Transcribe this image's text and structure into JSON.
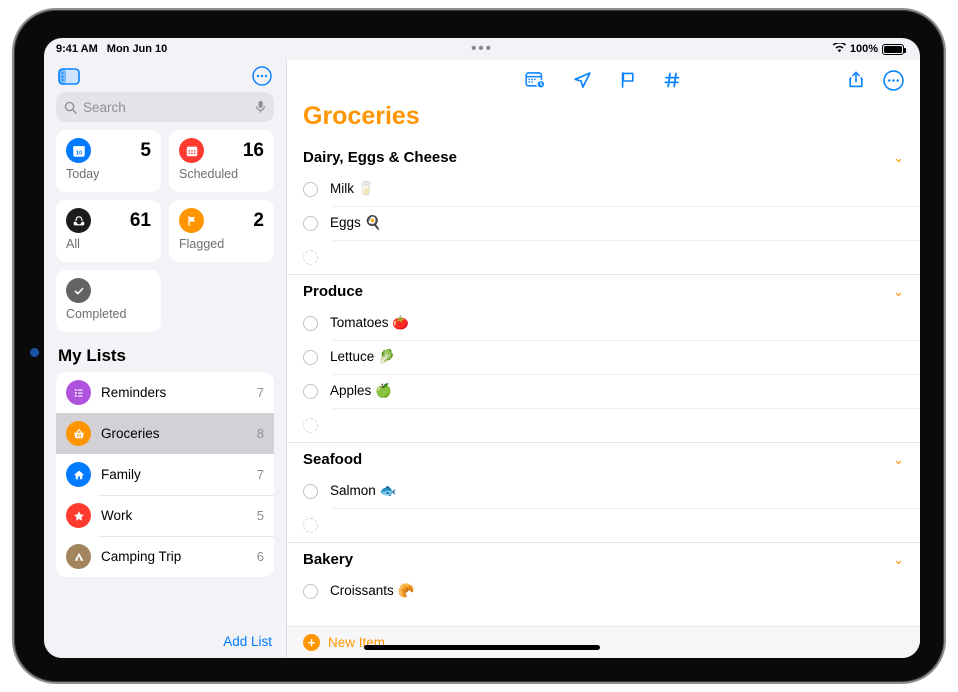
{
  "status_bar": {
    "time": "9:41 AM",
    "date": "Mon Jun 10",
    "wifi_icon": "wifi-icon",
    "battery_percent": "100%"
  },
  "sidebar": {
    "toggle_icon": "sidebar-toggle-icon",
    "more_icon": "more-options-icon",
    "search": {
      "placeholder": "Search",
      "search_icon": "search-icon",
      "mic_icon": "microphone-icon"
    },
    "smart_lists": [
      {
        "label": "Today",
        "count": "5",
        "icon": "calendar-day-icon",
        "color": "#007aff"
      },
      {
        "label": "Scheduled",
        "count": "16",
        "icon": "calendar-icon",
        "color": "#ff3b30"
      },
      {
        "label": "All",
        "count": "61",
        "icon": "inbox-tray-icon",
        "color": "#1c1c1e"
      },
      {
        "label": "Flagged",
        "count": "2",
        "icon": "flag-icon",
        "color": "#ff9500"
      },
      {
        "label": "Completed",
        "count": "",
        "icon": "checkmark-icon",
        "color": "#636366"
      }
    ],
    "my_lists_title": "My Lists",
    "lists": [
      {
        "name": "Reminders",
        "count": "7",
        "icon": "bulleted-list-icon",
        "color": "#af52de",
        "selected": false
      },
      {
        "name": "Groceries",
        "count": "8",
        "icon": "basket-icon",
        "color": "#ff9500",
        "selected": true
      },
      {
        "name": "Family",
        "count": "7",
        "icon": "house-icon",
        "color": "#007aff",
        "selected": false
      },
      {
        "name": "Work",
        "count": "5",
        "icon": "star-icon",
        "color": "#ff3b30",
        "selected": false
      },
      {
        "name": "Camping Trip",
        "count": "6",
        "icon": "tent-icon",
        "color": "#a2845e",
        "selected": false
      }
    ],
    "add_list_label": "Add List"
  },
  "main": {
    "toolbar": {
      "date_icon": "calendar-clock-icon",
      "location_icon": "location-arrow-icon",
      "flag_icon": "flag-outline-icon",
      "tag_icon": "hashtag-tag-icon",
      "share_icon": "share-icon",
      "more_icon": "more-options-icon"
    },
    "title": "Groceries",
    "title_color": "#ff9500",
    "sections": [
      {
        "title": "Dairy, Eggs & Cheese",
        "chevron_icon": "chevron-down-icon",
        "items": [
          {
            "text": "Milk 🥛",
            "empty": false
          },
          {
            "text": "Eggs 🍳",
            "empty": false
          },
          {
            "text": "",
            "empty": true
          }
        ]
      },
      {
        "title": "Produce",
        "chevron_icon": "chevron-down-icon",
        "items": [
          {
            "text": "Tomatoes 🍅",
            "empty": false
          },
          {
            "text": "Lettuce 🥬",
            "empty": false
          },
          {
            "text": "Apples 🍏",
            "empty": false
          },
          {
            "text": "",
            "empty": true
          }
        ]
      },
      {
        "title": "Seafood",
        "chevron_icon": "chevron-down-icon",
        "items": [
          {
            "text": "Salmon 🐟",
            "empty": false
          },
          {
            "text": "",
            "empty": true
          }
        ]
      },
      {
        "title": "Bakery",
        "chevron_icon": "chevron-down-icon",
        "items": [
          {
            "text": "Croissants 🥐",
            "empty": false
          }
        ]
      }
    ],
    "new_item_label": "New Item",
    "new_item_icon": "plus-circle-icon"
  }
}
